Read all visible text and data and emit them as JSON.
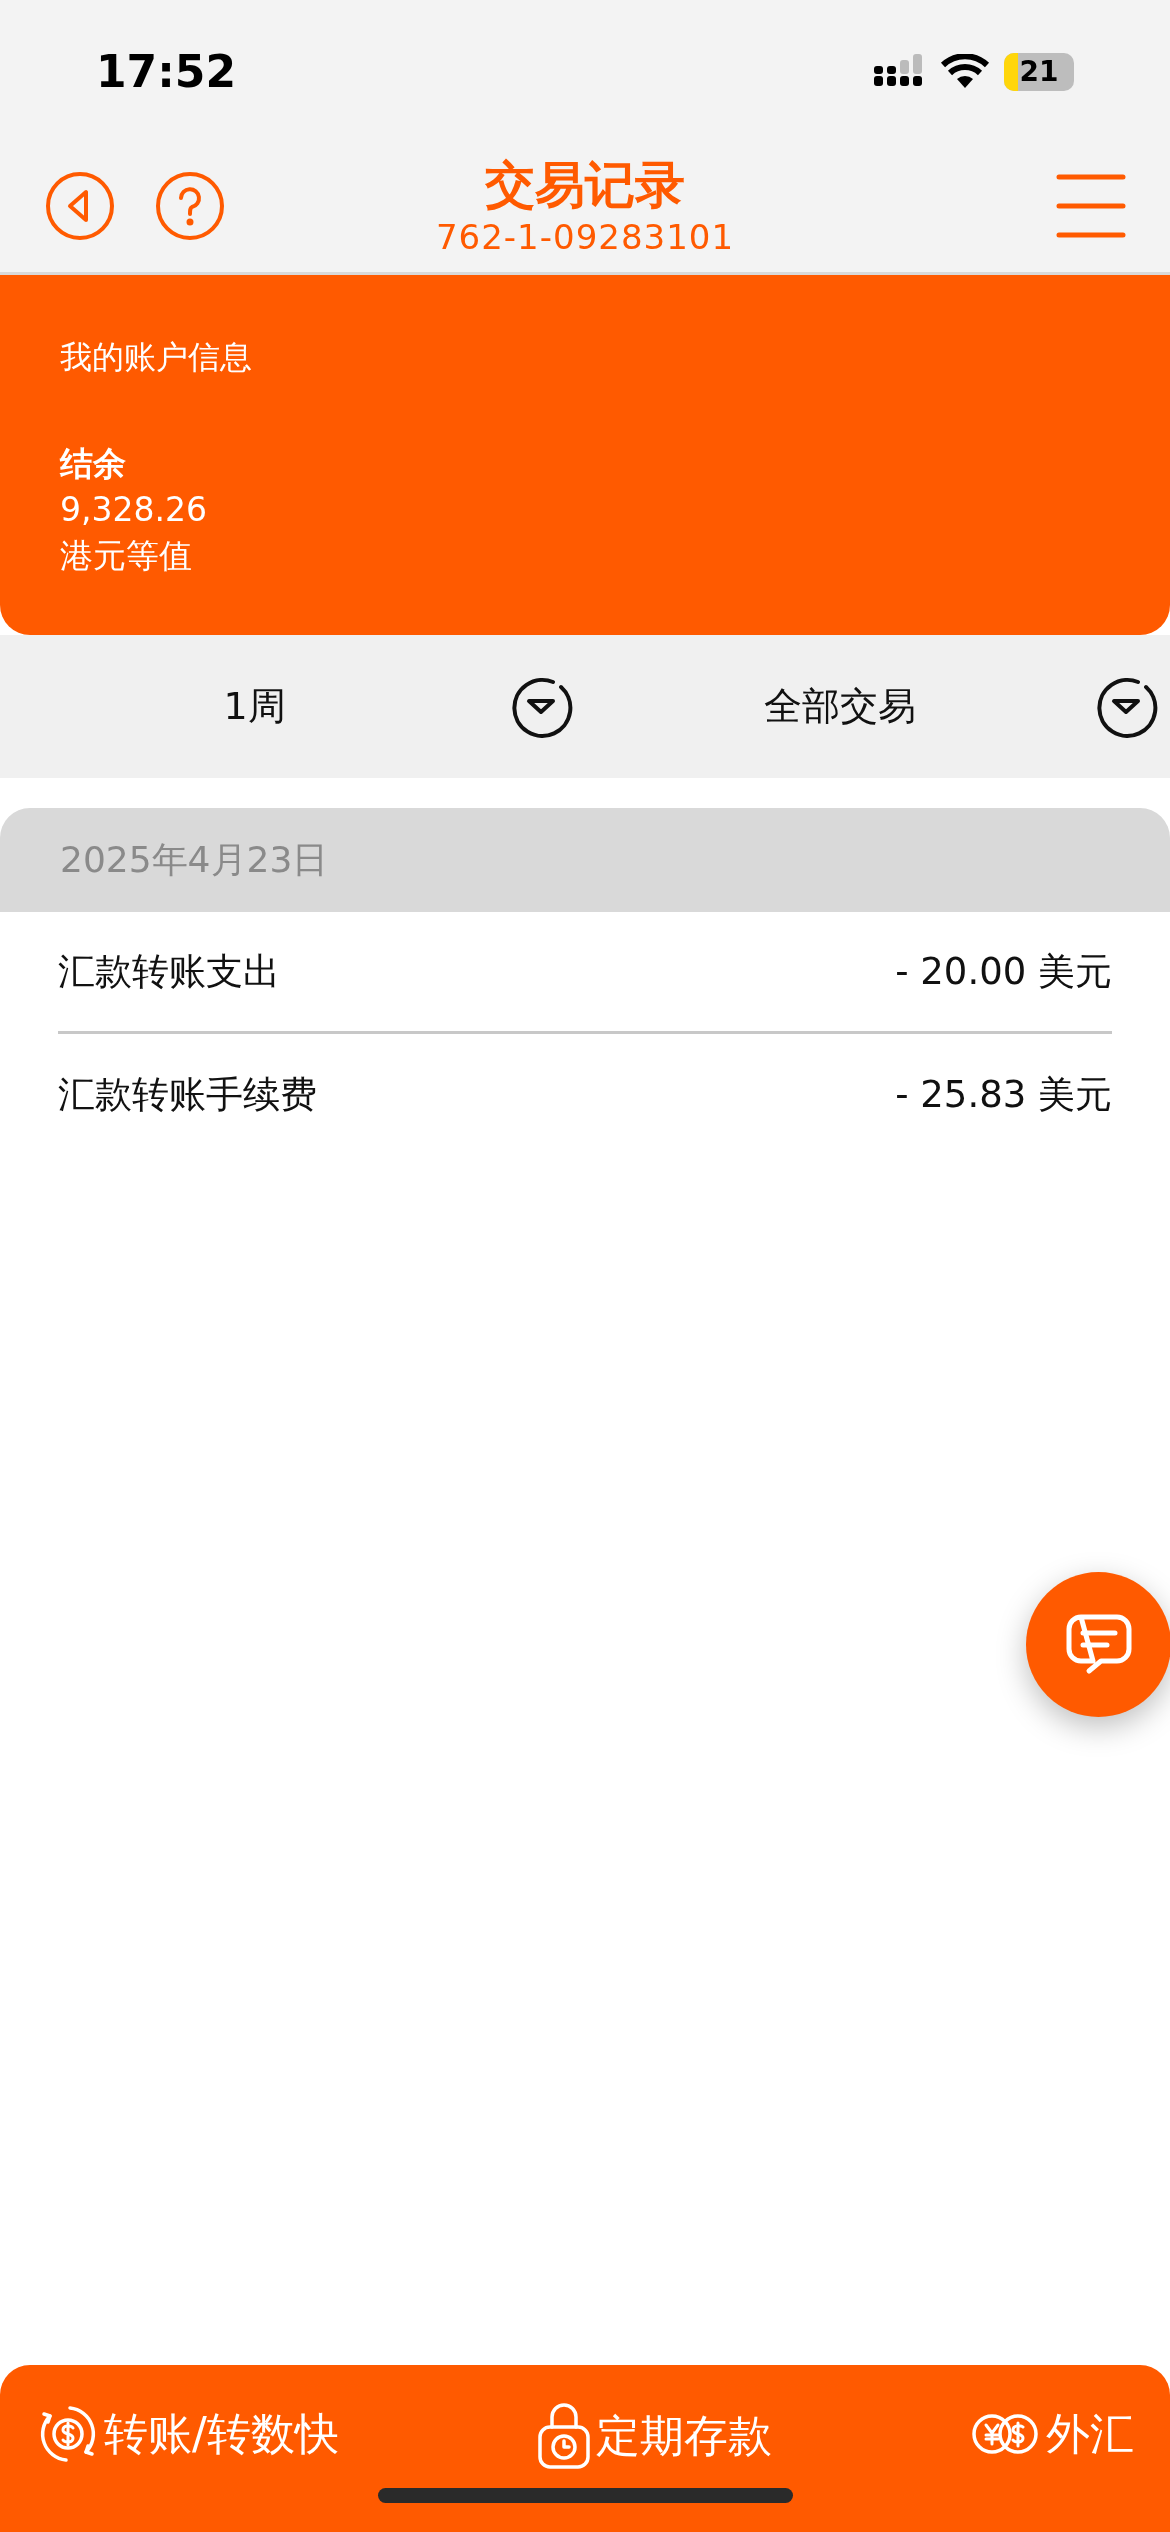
{
  "status_bar": {
    "time": "17:52",
    "battery": "21"
  },
  "header": {
    "title": "交易记录",
    "account_number": "762-1-09283101"
  },
  "account_card": {
    "heading": "我的账户信息",
    "balance_label": "结余",
    "balance": "9,328.26",
    "currency_note": "港元等值"
  },
  "filters": [
    {
      "label": "1周"
    },
    {
      "label": "全部交易"
    }
  ],
  "date_groups": [
    {
      "date": "2025年4月23日",
      "transactions": [
        {
          "description": "汇款转账支出",
          "amount": "- 20.00 美元"
        },
        {
          "description": "汇款转账手续费",
          "amount": "- 25.83 美元"
        }
      ]
    }
  ],
  "bottom_bar": [
    {
      "kind": "transfer",
      "label": "转账/转数快"
    },
    {
      "kind": "deposit",
      "label": "定期存款"
    },
    {
      "kind": "fx",
      "label": "外汇"
    }
  ]
}
